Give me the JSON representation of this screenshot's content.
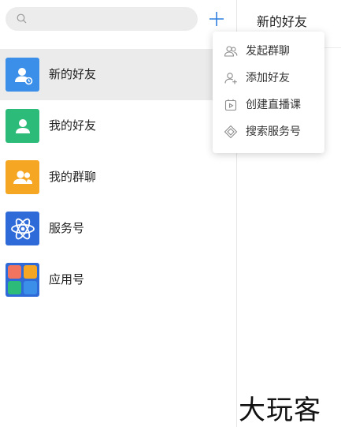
{
  "search": {
    "placeholder": "",
    "value": ""
  },
  "add_button": {
    "icon": "plus-icon"
  },
  "contacts": {
    "items": [
      {
        "label": "新的好友",
        "icon": "new-friend-icon",
        "color": "#3b8fe8",
        "selected": true
      },
      {
        "label": "我的好友",
        "icon": "friend-icon",
        "color": "#2dbb7a",
        "selected": false
      },
      {
        "label": "我的群聊",
        "icon": "group-icon",
        "color": "#f5a623",
        "selected": false
      },
      {
        "label": "服务号",
        "icon": "atom-icon",
        "color": "#2f6ad9",
        "selected": false
      },
      {
        "label": "应用号",
        "icon": "apps-grid-icon",
        "color": "#2f6ad9",
        "selected": false
      }
    ]
  },
  "panel": {
    "title": "新的好友"
  },
  "add_menu": {
    "items": [
      {
        "label": "发起群聊",
        "icon": "group-chat-icon"
      },
      {
        "label": "添加好友",
        "icon": "add-friend-icon"
      },
      {
        "label": "创建直播课",
        "icon": "live-class-icon"
      },
      {
        "label": "搜索服务号",
        "icon": "search-service-icon"
      }
    ]
  },
  "watermark": {
    "text": "大玩客"
  },
  "colors": {
    "accent": "#2f7de1",
    "selected_bg": "#ebebeb",
    "search_bg": "#ececec"
  }
}
